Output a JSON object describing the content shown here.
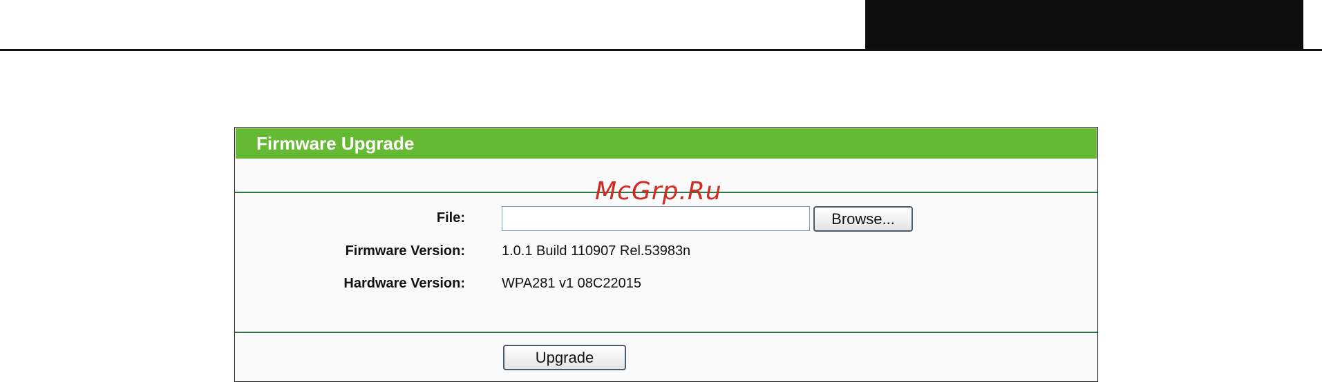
{
  "watermark": "McGrp.Ru",
  "panel": {
    "title": "Firmware Upgrade"
  },
  "form": {
    "file_label": "File:",
    "file_value": "",
    "browse_label": "Browse...",
    "firmware_label": "Firmware Version:",
    "firmware_value": "1.0.1 Build 110907 Rel.53983n",
    "hardware_label": "Hardware Version:",
    "hardware_value": "WPA281 v1 08C22015",
    "upgrade_label": "Upgrade"
  },
  "colors": {
    "title_bar": "#66b933",
    "divider": "#2c7546",
    "watermark": "#cf2b22"
  }
}
